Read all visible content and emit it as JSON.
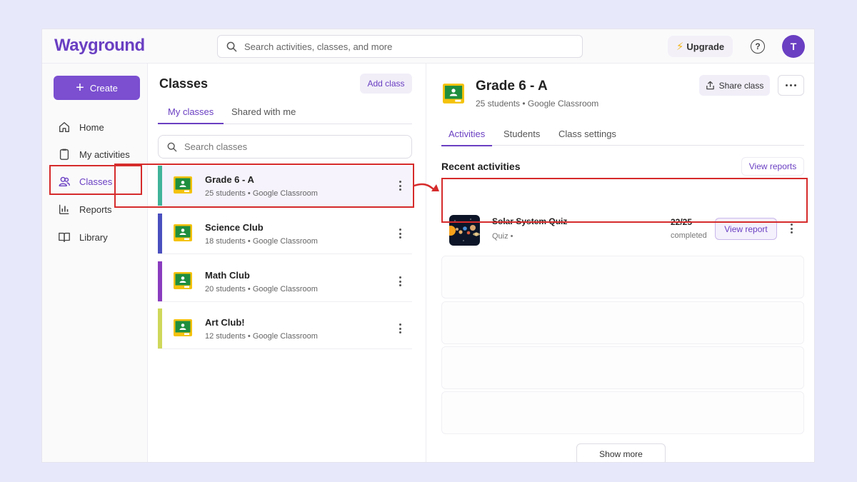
{
  "header": {
    "logo": "Wayground",
    "search_placeholder": "Search activities, classes, and more",
    "upgrade_label": "Upgrade",
    "help_glyph": "?",
    "avatar_initial": "T"
  },
  "sidebar": {
    "create_label": "Create",
    "items": [
      {
        "label": "Home",
        "icon": "home-icon"
      },
      {
        "label": "My activities",
        "icon": "clipboard-icon"
      },
      {
        "label": "Classes",
        "icon": "users-icon"
      },
      {
        "label": "Reports",
        "icon": "bar-chart-icon"
      },
      {
        "label": "Library",
        "icon": "book-icon"
      }
    ],
    "active": "Classes"
  },
  "classes_panel": {
    "title": "Classes",
    "add_label": "Add class",
    "tabs": [
      "My classes",
      "Shared with me"
    ],
    "active_tab": "My classes",
    "search_placeholder": "Search classes",
    "classes": [
      {
        "name": "Grade 6 - A",
        "meta": "25 students  •  Google Classroom",
        "color": "#3fb39a"
      },
      {
        "name": "Science Club",
        "meta": "18 students  •  Google Classroom",
        "color": "#4a4fbf"
      },
      {
        "name": "Math Club",
        "meta": "20 students  •  Google Classroom",
        "color": "#8a3dbf"
      },
      {
        "name": "Art Club!",
        "meta": "12 students  •  Google Classroom",
        "color": "#cfd85a"
      }
    ]
  },
  "detail": {
    "title": "Grade 6 - A",
    "meta": "25 students  •  Google Classroom",
    "share_label": "Share class",
    "tabs": [
      "Activities",
      "Students",
      "Class settings"
    ],
    "active_tab": "Activities",
    "recent_title": "Recent activities",
    "view_reports_label": "View reports",
    "activity": {
      "name": "Solar System Quiz",
      "type": "Quiz  •",
      "count": "22/25",
      "status": "completed",
      "button": "View report"
    },
    "show_more_label": "Show more"
  },
  "colors": {
    "accent": "#6a3fc2",
    "highlight": "#d62b2b",
    "classroom_green": "#1e8e3e",
    "classroom_yellow": "#f4c20d"
  }
}
